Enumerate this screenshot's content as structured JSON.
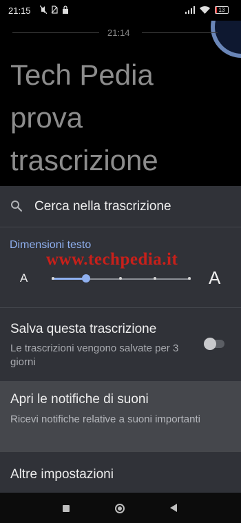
{
  "status_bar": {
    "time": "21:15",
    "battery": "13",
    "icons": [
      "muted-icon",
      "no-sim-icon",
      "lock-icon",
      "signal-icon",
      "wifi-icon",
      "battery-icon"
    ]
  },
  "transcript": {
    "timestamp": "21:14",
    "text": "Tech Pedia prova trascrizione"
  },
  "search": {
    "label": "Cerca nella trascrizione"
  },
  "text_size": {
    "title": "Dimensioni testo",
    "small_label": "A",
    "large_label": "A",
    "steps": 5,
    "selected_step": 2
  },
  "save": {
    "title": "Salva questa trascrizione",
    "description": "Le trascrizioni vengono salvate per 3 giorni",
    "enabled": false
  },
  "notifications": {
    "title": "Apri le notifiche di suoni",
    "description": "Ricevi notifiche relative a suoni importanti"
  },
  "other": {
    "title": "Altre impostazioni"
  },
  "watermark": "www.techpedia.it",
  "colors": {
    "accent": "#8fb0f0",
    "panel": "#303238",
    "highlight_row": "#45474c",
    "watermark": "#c8201a"
  }
}
